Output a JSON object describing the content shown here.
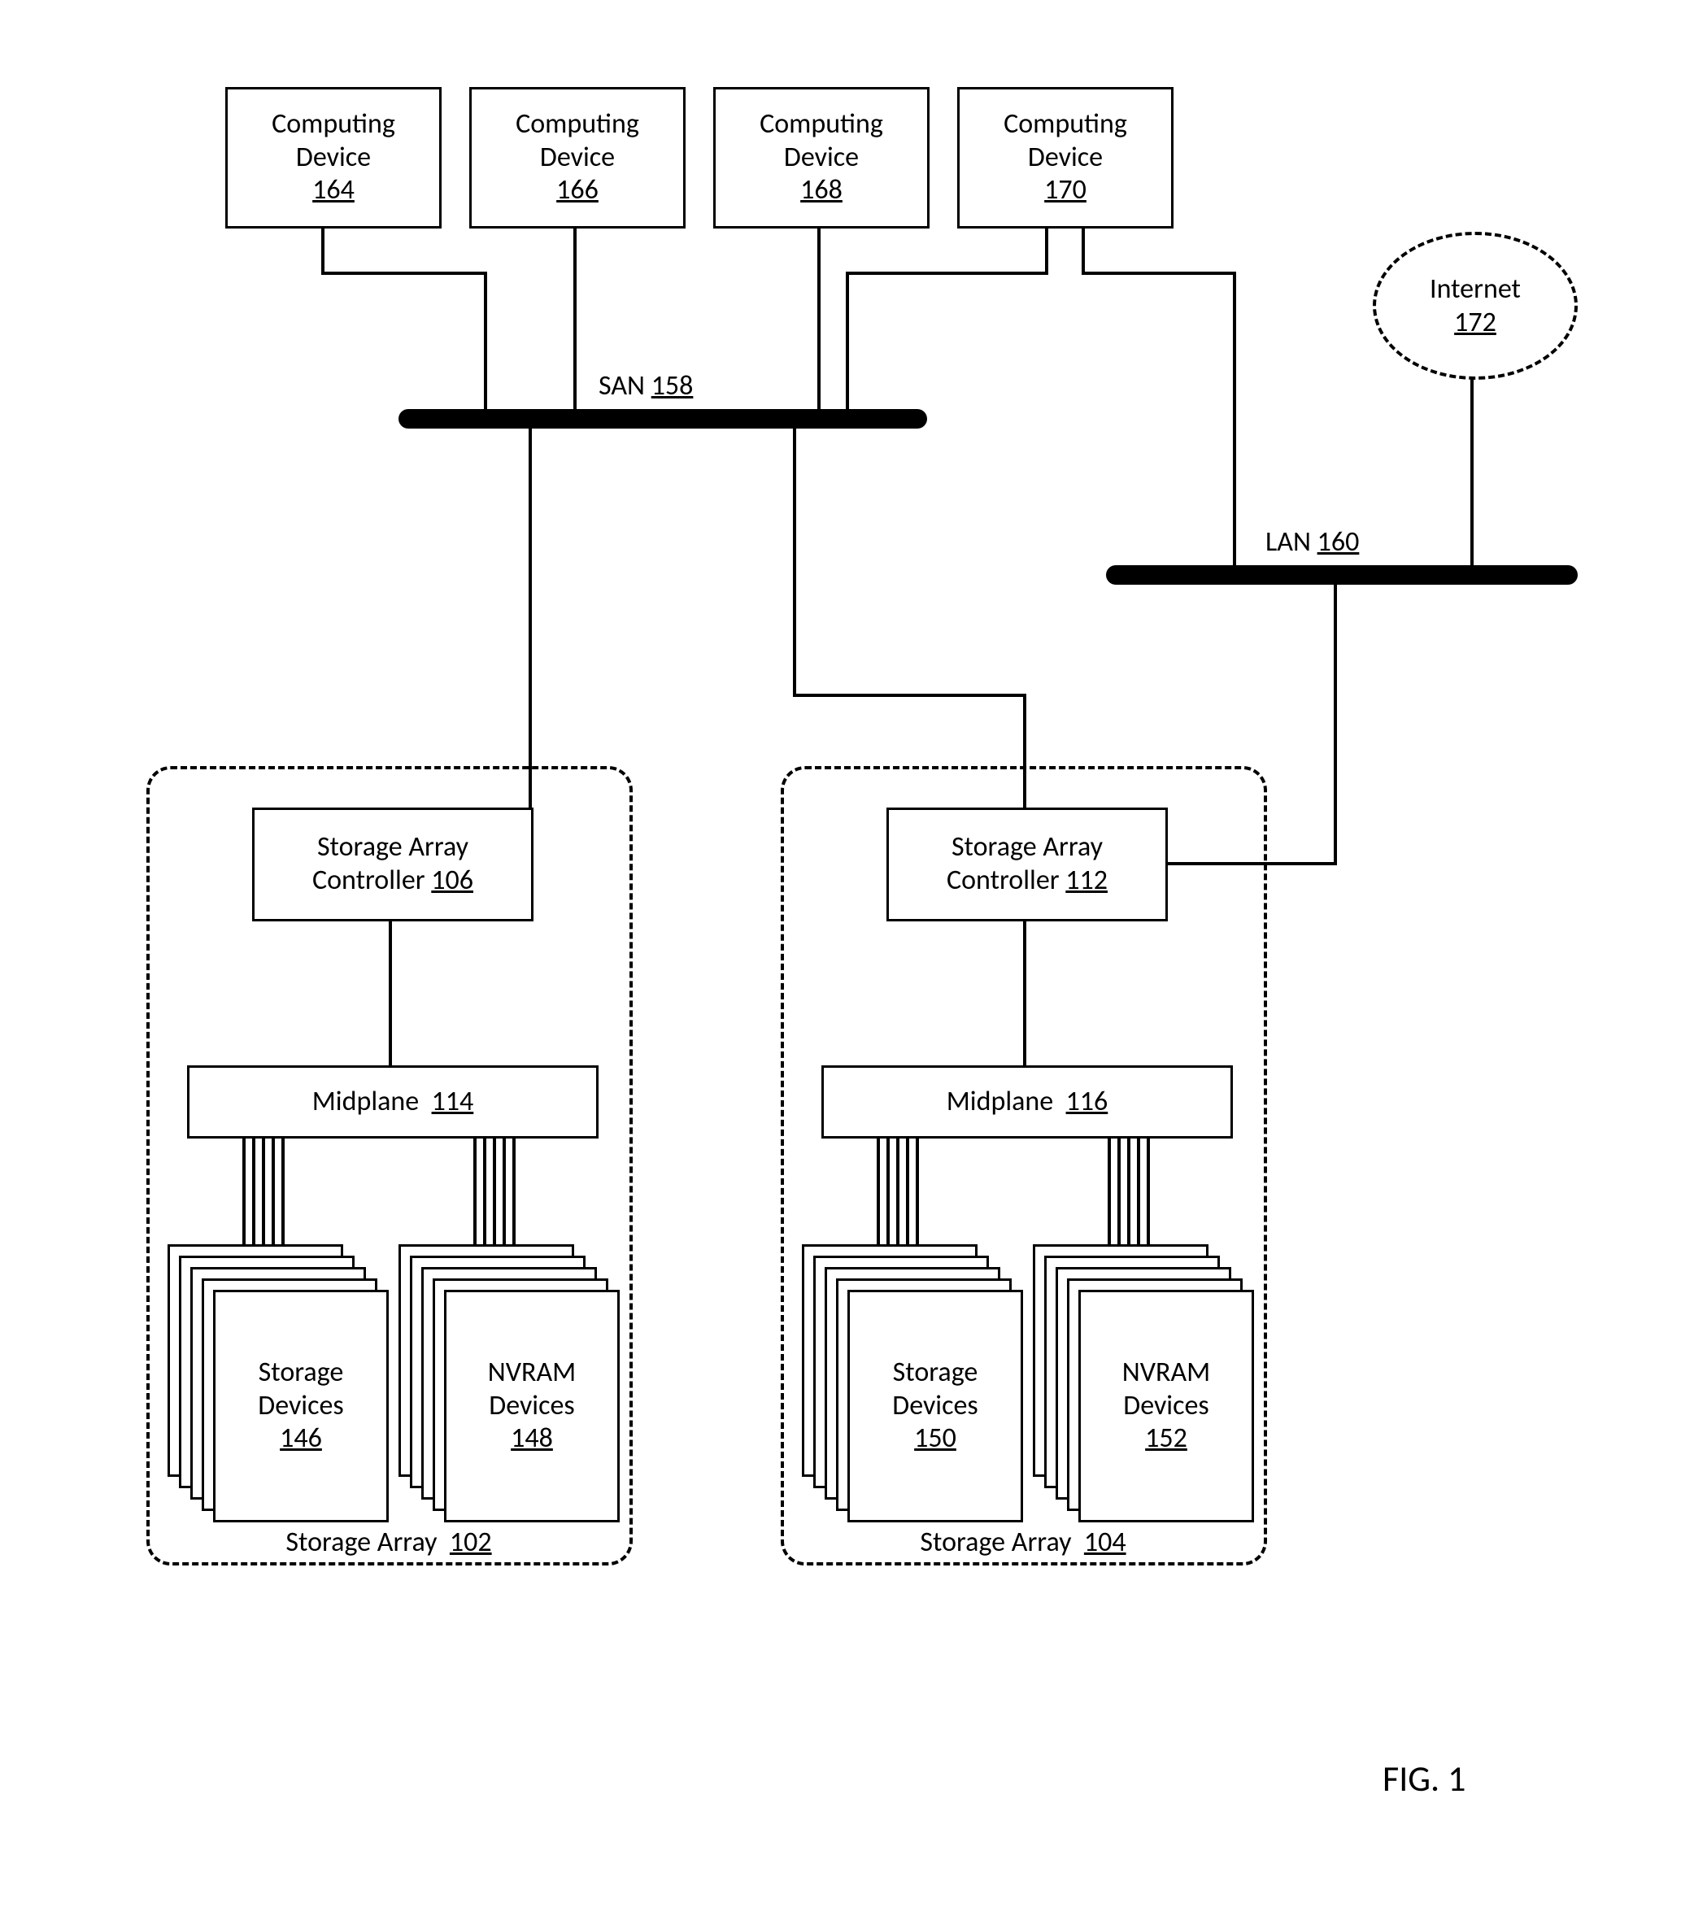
{
  "figure_label": "FIG. 1",
  "computing_devices": [
    {
      "title": "Computing Device",
      "ref": "164"
    },
    {
      "title": "Computing Device",
      "ref": "166"
    },
    {
      "title": "Computing Device",
      "ref": "168"
    },
    {
      "title": "Computing Device",
      "ref": "170"
    }
  ],
  "san": {
    "label": "SAN",
    "ref": "158"
  },
  "lan": {
    "label": "LAN",
    "ref": "160"
  },
  "internet": {
    "label": "Internet",
    "ref": "172"
  },
  "storage_arrays": [
    {
      "name": "Storage Array",
      "ref": "102",
      "controller": {
        "label": "Storage Array Controller",
        "ref": "106"
      },
      "midplane": {
        "label": "Midplane",
        "ref": "114"
      },
      "storage_devices": {
        "label": "Storage Devices",
        "ref": "146"
      },
      "nvram_devices": {
        "label": "NVRAM Devices",
        "ref": "148"
      }
    },
    {
      "name": "Storage Array",
      "ref": "104",
      "controller": {
        "label": "Storage Array Controller",
        "ref": "112"
      },
      "midplane": {
        "label": "Midplane",
        "ref": "116"
      },
      "storage_devices": {
        "label": "Storage Devices",
        "ref": "150"
      },
      "nvram_devices": {
        "label": "NVRAM Devices",
        "ref": "152"
      }
    }
  ]
}
